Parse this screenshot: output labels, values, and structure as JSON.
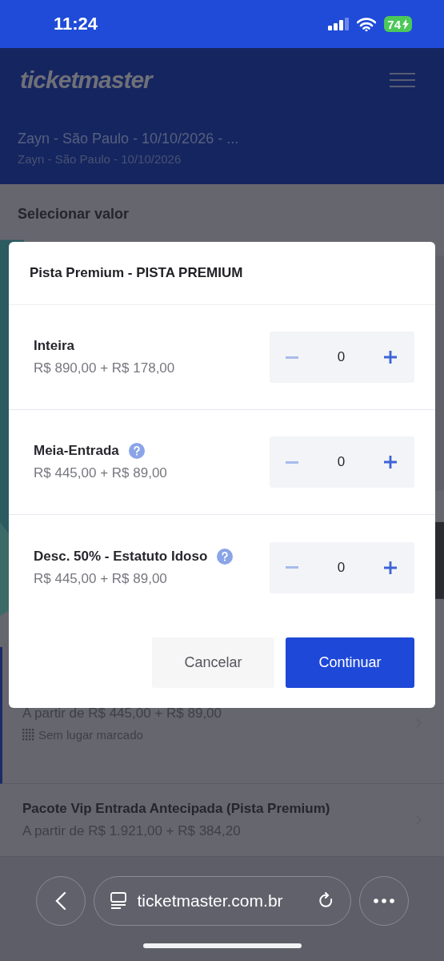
{
  "status_bar": {
    "time": "11:24",
    "battery": "74"
  },
  "header": {
    "logo": "ticketmaster"
  },
  "event": {
    "title": "Zayn - São Paulo - 10/10/2026 - ...",
    "subtitle": "Zayn - São Paulo - 10/10/2026"
  },
  "section_title": "Selecionar valor",
  "background_list": [
    {
      "price": "A partir de R$ 445,00 + R$ 89,00",
      "seating": "Sem lugar marcado",
      "selected": true
    },
    {
      "title": "Pacote Vip Entrada Antecipada (Pista Premium)",
      "price": "A partir de R$ 1.921,00 + R$ 384,20",
      "selected": false
    }
  ],
  "modal": {
    "title": "Pista Premium - PISTA PREMIUM",
    "tickets": [
      {
        "name": "Inteira",
        "price": "R$ 890,00 + R$ 178,00",
        "help": false,
        "quantity": "0",
        "minus_disabled": true
      },
      {
        "name": "Meia-Entrada",
        "price": "R$ 445,00 + R$ 89,00",
        "help": true,
        "quantity": "0",
        "minus_disabled": true
      },
      {
        "name": "Desc. 50% - Estatuto Idoso",
        "price": "R$ 445,00 + R$ 89,00",
        "help": true,
        "quantity": "0",
        "minus_disabled": true
      }
    ],
    "buttons": [
      {
        "label": "Cancelar",
        "kind": "secondary"
      },
      {
        "label": "Continuar",
        "kind": "primary"
      }
    ]
  },
  "browser": {
    "url": "ticketmaster.com.br"
  }
}
